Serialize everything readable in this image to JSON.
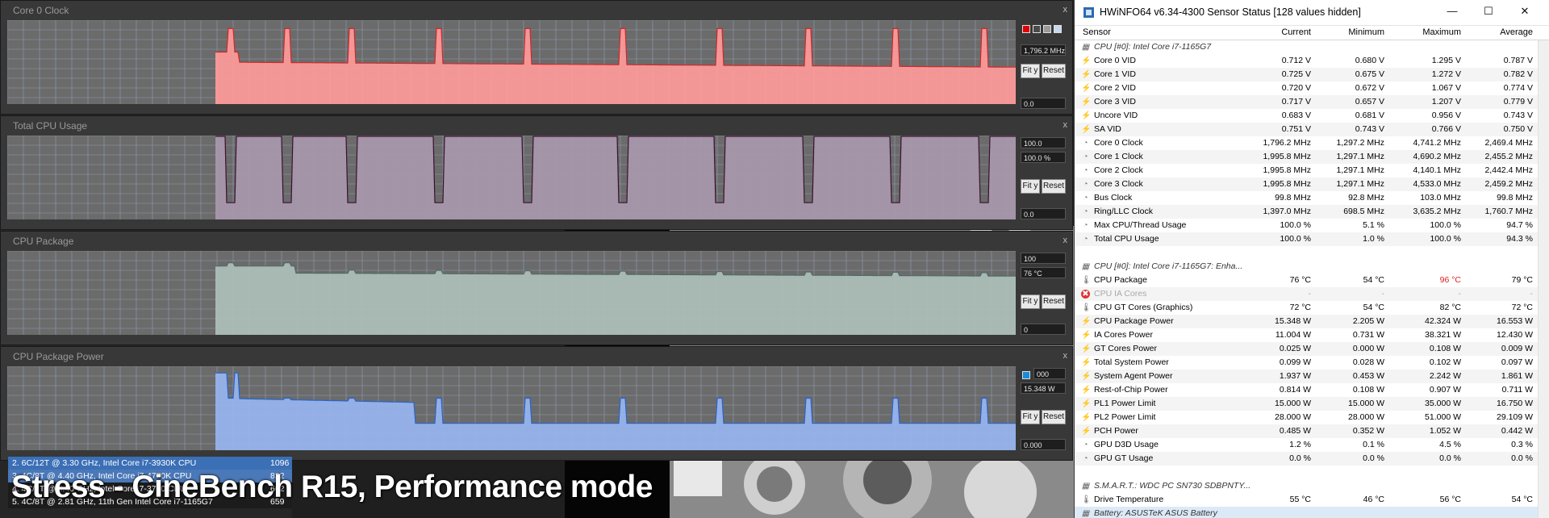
{
  "graphs": [
    {
      "title": "Core 0 Clock",
      "max_label": "",
      "current_label": "1,796.2 MHz",
      "min_label": "0.0",
      "colors": [
        "#e00000",
        "#4a4a4a",
        "#9a9a9a",
        "#c8d8f0"
      ],
      "fill": "#ff9a9a",
      "stroke": "#cc2a2a",
      "profile": "clock"
    },
    {
      "title": "Total CPU Usage",
      "max_label": "100.0",
      "current_label": "100.0 %",
      "min_label": "0.0",
      "colors": [],
      "fill": "#a898ad",
      "stroke": "#3e1030",
      "profile": "usage"
    },
    {
      "title": "CPU Package",
      "max_label": "100",
      "current_label": "76 °C",
      "min_label": "0",
      "colors": [],
      "fill": "#aebfb9",
      "stroke": "#4f6a66",
      "profile": "temp"
    },
    {
      "title": "CPU Package Power",
      "max_label": "000",
      "current_label": "15.348 W",
      "min_label": "0.000",
      "colors": [
        "#1a8ad8"
      ],
      "fill": "#98b5f0",
      "stroke": "#2a64c8",
      "profile": "power"
    }
  ],
  "buttons": {
    "fit": "Fit y",
    "reset": "Reset",
    "close": "x"
  },
  "benchmark": {
    "rows": [
      {
        "label": "2. 6C/12T @ 3.30 GHz,  Intel Core i7-3930K CPU",
        "score": "1096",
        "highlight": true
      },
      {
        "label": "3. 4C/8T @ 4.40 GHz, Intel Core i7-4770K CPU",
        "score": "822",
        "highlight": false
      },
      {
        "label": "4. 4C/8T @ 3.40 GHz, Intel Core i7-3770 CPU",
        "score": "662",
        "highlight": false
      },
      {
        "label": "5. 4C/8T @ 2.81 GHz, 11th Gen Intel Core i7-1165G7",
        "score": "659",
        "highlight": false
      }
    ],
    "caption": "Stress - CineBench R15, Performance mode"
  },
  "hwinfo": {
    "title": "HWiNFO64 v6.34-4300 Sensor Status [128 values hidden]",
    "controls": {
      "minimize": "—",
      "maximize": "☐",
      "close": "✕"
    },
    "columns": [
      "Sensor",
      "Current",
      "Minimum",
      "Maximum",
      "Average"
    ],
    "rows": [
      {
        "kind": "group",
        "icon": "chip",
        "label": "CPU [#0]: Intel Core i7-1165G7"
      },
      {
        "icon": "bolt",
        "label": "Core 0 VID",
        "current": "0.712 V",
        "min": "0.680 V",
        "max": "1.295 V",
        "avg": "0.787 V"
      },
      {
        "icon": "bolt",
        "label": "Core 1 VID",
        "current": "0.725 V",
        "min": "0.675 V",
        "max": "1.272 V",
        "avg": "0.782 V"
      },
      {
        "icon": "bolt",
        "label": "Core 2 VID",
        "current": "0.720 V",
        "min": "0.672 V",
        "max": "1.067 V",
        "avg": "0.774 V"
      },
      {
        "icon": "bolt",
        "label": "Core 3 VID",
        "current": "0.717 V",
        "min": "0.657 V",
        "max": "1.207 V",
        "avg": "0.779 V"
      },
      {
        "icon": "bolt",
        "label": "Uncore VID",
        "current": "0.683 V",
        "min": "0.681 V",
        "max": "0.956 V",
        "avg": "0.743 V"
      },
      {
        "icon": "bolt",
        "label": "SA VID",
        "current": "0.751 V",
        "min": "0.743 V",
        "max": "0.766 V",
        "avg": "0.750 V"
      },
      {
        "icon": "clock",
        "label": "Core 0 Clock",
        "current": "1,796.2 MHz",
        "min": "1,297.2 MHz",
        "max": "4,741.2 MHz",
        "avg": "2,469.4 MHz"
      },
      {
        "icon": "clock",
        "label": "Core 1 Clock",
        "current": "1,995.8 MHz",
        "min": "1,297.1 MHz",
        "max": "4,690.2 MHz",
        "avg": "2,455.2 MHz"
      },
      {
        "icon": "clock",
        "label": "Core 2 Clock",
        "current": "1,995.8 MHz",
        "min": "1,297.1 MHz",
        "max": "4,140.1 MHz",
        "avg": "2,442.4 MHz"
      },
      {
        "icon": "clock",
        "label": "Core 3 Clock",
        "current": "1,995.8 MHz",
        "min": "1,297.1 MHz",
        "max": "4,533.0 MHz",
        "avg": "2,459.2 MHz"
      },
      {
        "icon": "clock",
        "label": "Bus Clock",
        "current": "99.8 MHz",
        "min": "92.8 MHz",
        "max": "103.0 MHz",
        "avg": "99.8 MHz"
      },
      {
        "icon": "clock",
        "label": "Ring/LLC Clock",
        "current": "1,397.0 MHz",
        "min": "698.5 MHz",
        "max": "3,635.2 MHz",
        "avg": "1,760.7 MHz"
      },
      {
        "icon": "clock",
        "label": "Max CPU/Thread Usage",
        "current": "100.0 %",
        "min": "5.1 %",
        "max": "100.0 %",
        "avg": "94.7 %"
      },
      {
        "icon": "clock",
        "label": "Total CPU Usage",
        "current": "100.0 %",
        "min": "1.0 %",
        "max": "100.0 %",
        "avg": "94.3 %"
      },
      {
        "kind": "blank"
      },
      {
        "kind": "group",
        "icon": "chip",
        "label": "CPU [#0]: Intel Core i7-1165G7: Enha..."
      },
      {
        "icon": "therm",
        "label": "CPU Package",
        "current": "76 °C",
        "min": "54 °C",
        "max": "96 °C",
        "avg": "79 °C",
        "max_color": "#e02020"
      },
      {
        "kind": "dim",
        "icon": "error",
        "label": "CPU IA Cores",
        "current": "-",
        "min": "-",
        "max": "-",
        "avg": "-"
      },
      {
        "icon": "therm",
        "label": "CPU GT Cores (Graphics)",
        "current": "72 °C",
        "min": "54 °C",
        "max": "82 °C",
        "avg": "72 °C"
      },
      {
        "icon": "bolt",
        "label": "CPU Package Power",
        "current": "15.348 W",
        "min": "2.205 W",
        "max": "42.324 W",
        "avg": "16.553 W"
      },
      {
        "icon": "bolt",
        "label": "IA Cores Power",
        "current": "11.004 W",
        "min": "0.731 W",
        "max": "38.321 W",
        "avg": "12.430 W"
      },
      {
        "icon": "bolt",
        "label": "GT Cores Power",
        "current": "0.025 W",
        "min": "0.000 W",
        "max": "0.108 W",
        "avg": "0.009 W"
      },
      {
        "icon": "bolt",
        "label": "Total System Power",
        "current": "0.099 W",
        "min": "0.028 W",
        "max": "0.102 W",
        "avg": "0.097 W"
      },
      {
        "icon": "bolt",
        "label": "System Agent Power",
        "current": "1.937 W",
        "min": "0.453 W",
        "max": "2.242 W",
        "avg": "1.861 W"
      },
      {
        "icon": "bolt",
        "label": "Rest-of-Chip Power",
        "current": "0.814 W",
        "min": "0.108 W",
        "max": "0.907 W",
        "avg": "0.711 W"
      },
      {
        "icon": "bolt",
        "label": "PL1 Power Limit",
        "current": "15.000 W",
        "min": "15.000 W",
        "max": "35.000 W",
        "avg": "16.750 W"
      },
      {
        "icon": "bolt",
        "label": "PL2 Power Limit",
        "current": "28.000 W",
        "min": "28.000 W",
        "max": "51.000 W",
        "avg": "29.109 W"
      },
      {
        "icon": "bolt",
        "label": "PCH Power",
        "current": "0.485 W",
        "min": "0.352 W",
        "max": "1.052 W",
        "avg": "0.442 W"
      },
      {
        "icon": "clock",
        "label": "GPU D3D Usage",
        "current": "1.2 %",
        "min": "0.1 %",
        "max": "4.5 %",
        "avg": "0.3 %"
      },
      {
        "icon": "clock",
        "label": "GPU GT Usage",
        "current": "0.0 %",
        "min": "0.0 %",
        "max": "0.0 %",
        "avg": "0.0 %"
      },
      {
        "kind": "blank"
      },
      {
        "kind": "group",
        "icon": "chip",
        "label": "S.M.A.R.T.: WDC PC SN730 SDBPNTY..."
      },
      {
        "icon": "therm",
        "label": "Drive Temperature",
        "current": "55 °C",
        "min": "46 °C",
        "max": "56 °C",
        "avg": "54 °C"
      },
      {
        "kind": "group-sel",
        "icon": "chip",
        "label": "Battery: ASUSTeK ASUS Battery"
      }
    ]
  }
}
